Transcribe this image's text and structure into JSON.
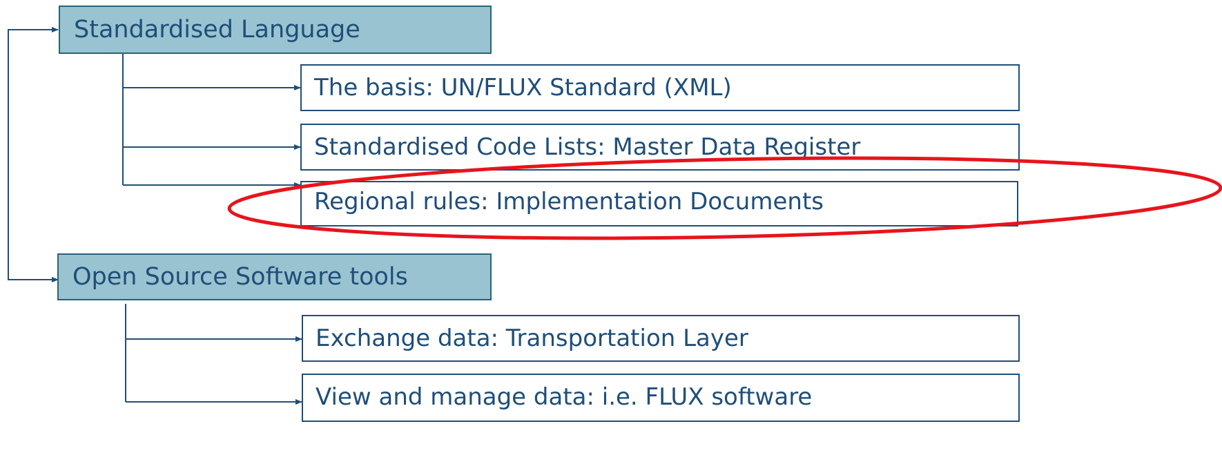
{
  "groups": [
    {
      "label": "Standardised Language",
      "children": [
        "The basis: UN/FLUX Standard (XML)",
        "Standardised Code Lists: Master Data Register",
        "Regional rules: Implementation Documents"
      ]
    },
    {
      "label": "Open Source Software tools",
      "children": [
        "Exchange data: Transportation Layer",
        "View and manage data: i.e. FLUX software"
      ]
    }
  ],
  "highlight": {
    "target": "Regional rules: Implementation Documents",
    "color": "#e8141b"
  },
  "colors": {
    "line": "#1f4e79",
    "parent_fill": "#9ac3d1",
    "text": "#1f4e79"
  }
}
